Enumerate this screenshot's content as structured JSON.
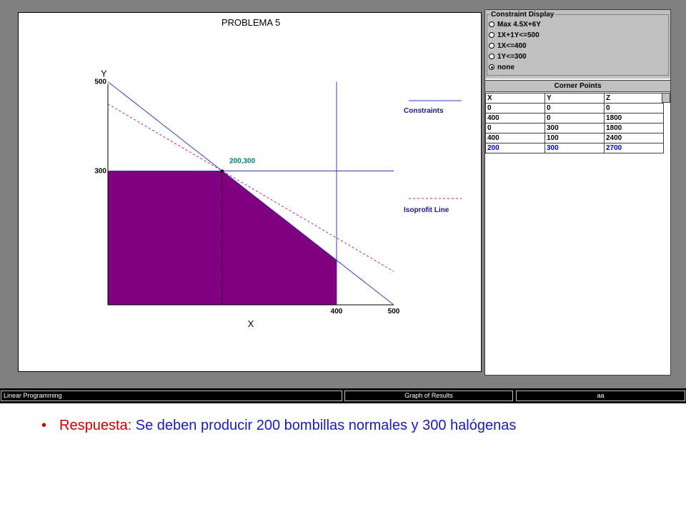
{
  "graph": {
    "title": "PROBLEMA 5",
    "y_axis_label": "Y",
    "x_axis_label": "X",
    "y_ticks": [
      "500",
      "300"
    ],
    "x_ticks": [
      "400",
      "500"
    ],
    "optimal_point_label": "200,300",
    "legend": {
      "constraints": "Constraints",
      "isoprofit": "Isoprofit Line"
    },
    "colors": {
      "feasible_region": "#800080",
      "constraint_lines": "#3b3bb0",
      "isoprofit_line": "#c0206a",
      "point_label": "#008080"
    }
  },
  "chart_data": {
    "type": "line",
    "title": "PROBLEMA 5",
    "xlabel": "X",
    "ylabel": "Y",
    "xlim": [
      0,
      500
    ],
    "ylim": [
      0,
      500
    ],
    "series": [
      {
        "name": "Constraints",
        "style": "solid",
        "lines": [
          {
            "label": "1X+1Y<=500",
            "points": [
              [
                0,
                500
              ],
              [
                500,
                0
              ]
            ]
          },
          {
            "label": "1X<=400",
            "points": [
              [
                400,
                0
              ],
              [
                400,
                500
              ]
            ]
          },
          {
            "label": "1Y<=300",
            "points": [
              [
                0,
                300
              ],
              [
                500,
                300
              ]
            ]
          }
        ]
      },
      {
        "name": "Isoprofit Line",
        "style": "dashed",
        "lines": [
          {
            "label": "Max 4.5X+6Y",
            "points": [
              [
                0,
                450
              ],
              [
                500,
                75
              ]
            ]
          }
        ]
      }
    ],
    "feasible_region": [
      [
        0,
        0
      ],
      [
        0,
        300
      ],
      [
        200,
        300
      ],
      [
        400,
        100
      ],
      [
        400,
        0
      ]
    ],
    "optimal_point": [
      200,
      300
    ]
  },
  "constraint_display": {
    "title": "Constraint Display",
    "options": [
      {
        "label": "Max 4.5X+6Y",
        "checked": false
      },
      {
        "label": "1X+1Y<=500",
        "checked": false
      },
      {
        "label": "1X<=400",
        "checked": false
      },
      {
        "label": "1Y<=300",
        "checked": false
      },
      {
        "label": "none",
        "checked": true
      }
    ]
  },
  "corner_points": {
    "title": "Corner Points",
    "headers": [
      "X",
      "Y",
      "Z"
    ],
    "rows": [
      [
        "0",
        "0",
        "0"
      ],
      [
        "400",
        "0",
        "1800"
      ],
      [
        "0",
        "300",
        "1800"
      ],
      [
        "400",
        "100",
        "2400"
      ],
      [
        "200",
        "300",
        "2700"
      ]
    ],
    "highlight_row": 4
  },
  "status_bar": {
    "left": "Linear Programming",
    "middle": "Graph of Results",
    "right": "aa"
  },
  "answer": {
    "bullet": "•",
    "label": "Respuesta:",
    "text": "Se deben producir 200 bombillas normales y 300 halógenas"
  }
}
